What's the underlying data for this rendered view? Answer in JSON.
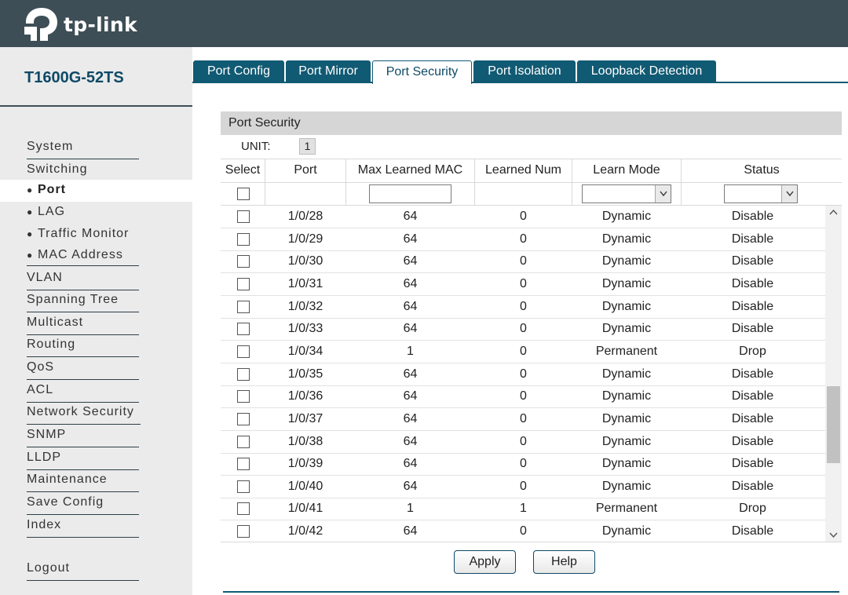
{
  "header": {
    "logo_text": "tp-link"
  },
  "sidebar": {
    "model": "T1600G-52TS",
    "items": [
      {
        "label": "System",
        "top": 0
      },
      {
        "label": "Switching"
      }
    ],
    "system": "System",
    "switching": "Switching",
    "port": "Port",
    "lag": "LAG",
    "traffic_monitor": "Traffic Monitor",
    "mac_address": "MAC Address",
    "vlan": "VLAN",
    "spanning_tree": "Spanning Tree",
    "multicast": "Multicast",
    "routing": "Routing",
    "qos": "QoS",
    "acl": "ACL",
    "network_security": "Network Security",
    "snmp": "SNMP",
    "lldp": "LLDP",
    "maintenance": "Maintenance",
    "save_config": "Save Config",
    "index": "Index",
    "logout": "Logout"
  },
  "tabs": {
    "port_config": "Port Config",
    "port_mirror": "Port Mirror",
    "port_security": "Port Security",
    "port_isolation": "Port Isolation",
    "loopback_detection": "Loopback Detection"
  },
  "panel": {
    "title": "Port Security",
    "unit_label": "UNIT:",
    "unit_value": "1",
    "columns": {
      "select": "Select",
      "port": "Port",
      "max_learned_mac": "Max Learned MAC",
      "learned_num": "Learned Num",
      "learn_mode": "Learn Mode",
      "status": "Status"
    },
    "filter": {
      "max_learned_mac": "",
      "learn_mode": "",
      "status": ""
    },
    "rows": [
      {
        "port": "1/0/28",
        "max": "64",
        "learned": "0",
        "mode": "Dynamic",
        "status": "Disable"
      },
      {
        "port": "1/0/29",
        "max": "64",
        "learned": "0",
        "mode": "Dynamic",
        "status": "Disable"
      },
      {
        "port": "1/0/30",
        "max": "64",
        "learned": "0",
        "mode": "Dynamic",
        "status": "Disable"
      },
      {
        "port": "1/0/31",
        "max": "64",
        "learned": "0",
        "mode": "Dynamic",
        "status": "Disable"
      },
      {
        "port": "1/0/32",
        "max": "64",
        "learned": "0",
        "mode": "Dynamic",
        "status": "Disable"
      },
      {
        "port": "1/0/33",
        "max": "64",
        "learned": "0",
        "mode": "Dynamic",
        "status": "Disable"
      },
      {
        "port": "1/0/34",
        "max": "1",
        "learned": "0",
        "mode": "Permanent",
        "status": "Drop"
      },
      {
        "port": "1/0/35",
        "max": "64",
        "learned": "0",
        "mode": "Dynamic",
        "status": "Disable"
      },
      {
        "port": "1/0/36",
        "max": "64",
        "learned": "0",
        "mode": "Dynamic",
        "status": "Disable"
      },
      {
        "port": "1/0/37",
        "max": "64",
        "learned": "0",
        "mode": "Dynamic",
        "status": "Disable"
      },
      {
        "port": "1/0/38",
        "max": "64",
        "learned": "0",
        "mode": "Dynamic",
        "status": "Disable"
      },
      {
        "port": "1/0/39",
        "max": "64",
        "learned": "0",
        "mode": "Dynamic",
        "status": "Disable"
      },
      {
        "port": "1/0/40",
        "max": "64",
        "learned": "0",
        "mode": "Dynamic",
        "status": "Disable"
      },
      {
        "port": "1/0/41",
        "max": "1",
        "learned": "1",
        "mode": "Permanent",
        "status": "Drop"
      },
      {
        "port": "1/0/42",
        "max": "64",
        "learned": "0",
        "mode": "Dynamic",
        "status": "Disable"
      }
    ]
  },
  "buttons": {
    "apply": "Apply",
    "help": "Help"
  },
  "colors": {
    "header_bg": "#3e4e56",
    "tab_bg": "#115a73",
    "brand_text": "#0e4a66",
    "sidebar_bg": "#ebebeb"
  }
}
